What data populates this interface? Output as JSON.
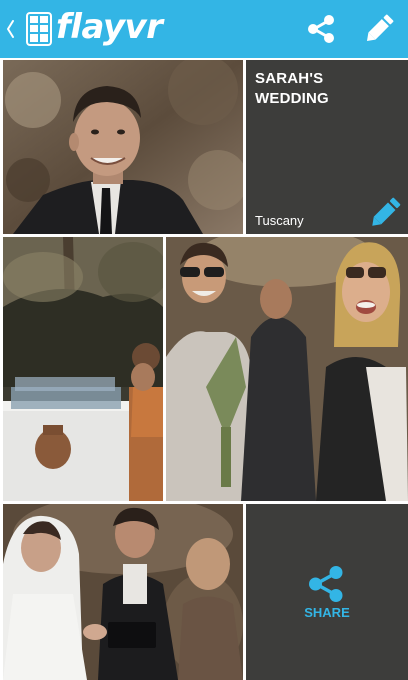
{
  "actionbar": {
    "app_name": "flayvr",
    "back_icon": "chevron-left-icon",
    "app_icon": "gallery-grid-icon",
    "share_icon": "share-icon",
    "edit_icon": "pencil-icon",
    "color": "#33b5e5"
  },
  "album": {
    "title": "SARAH'S WEDDING",
    "location": "Tuscany",
    "edit_icon": "pencil-icon",
    "tile_color": "#3d3d3b"
  },
  "share_tile": {
    "label": "SHARE",
    "icon": "share-icon",
    "accent": "#33b5e5"
  },
  "photos": [
    {
      "id": "groom-smiling-portrait"
    },
    {
      "id": "lavender-table-garden"
    },
    {
      "id": "guests-with-sunglasses"
    },
    {
      "id": "wedding-ceremony-vows"
    }
  ]
}
